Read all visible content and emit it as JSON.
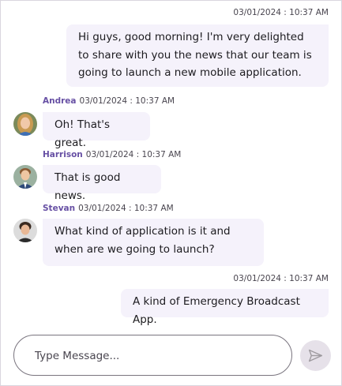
{
  "messages": [
    {
      "time": "03/01/2024 : 10:37 AM",
      "text": "Hi guys, good morning! I'm very delighted to share with you the news that our team is going to launch a new mobile application."
    },
    {
      "author": "Andrea",
      "time": "03/01/2024 : 10:37 AM",
      "text": "Oh! That's great."
    },
    {
      "author": "Harrison",
      "time": "03/01/2024 : 10:37 AM",
      "text": "That is good news."
    },
    {
      "author": "Stevan",
      "time": "03/01/2024 : 10:37 AM",
      "text": "What kind of application is it and when are we going to launch?"
    },
    {
      "time": "03/01/2024 : 10:37 AM",
      "text": "A kind of Emergency Broadcast App."
    }
  ],
  "composer": {
    "placeholder": "Type Message..."
  },
  "icons": {
    "send": "send-icon"
  },
  "colors": {
    "accent": "#6750a4",
    "bubble": "#f5f2fb",
    "send_bg": "#e6e1e9"
  }
}
